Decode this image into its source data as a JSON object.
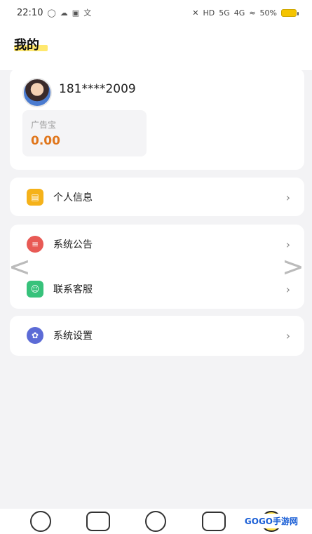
{
  "status_bar": {
    "time": "22:10",
    "left_icons": [
      "circle-icon",
      "cloud-icon",
      "image-icon",
      "translate-icon"
    ],
    "right_icons": [
      "bell-off-icon",
      "hd-icon",
      "signal-5g-icon",
      "signal-4g-icon",
      "wifi-icon"
    ],
    "battery_text": "50%"
  },
  "page": {
    "title": "我的"
  },
  "profile": {
    "phone": "181****2009",
    "ad_label": "广告宝",
    "ad_value": "0.00"
  },
  "menu": {
    "personal_info": "个人信息",
    "announcement": "系统公告",
    "customer_service": "联系客服",
    "settings": "系统设置"
  },
  "carousel": {
    "left_arrow": "<",
    "right_arrow": ">"
  },
  "bottom_nav": {
    "tabs": [
      "home-icon",
      "chart-icon",
      "gauge-icon",
      "bag-icon",
      "user-icon"
    ]
  },
  "watermark": {
    "text": "GOGO手游网"
  },
  "colors": {
    "accent": "#ffe24a",
    "value": "#e0761c"
  }
}
